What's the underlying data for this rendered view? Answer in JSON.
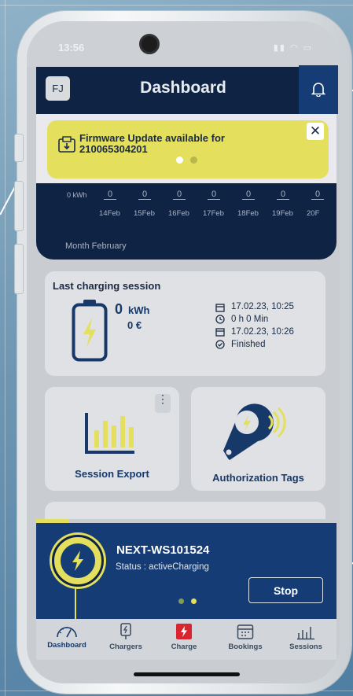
{
  "status": {
    "time": "13:56"
  },
  "header": {
    "title": "Dashboard",
    "avatar_initials": "FJ"
  },
  "banner": {
    "message": "Firmware Update available for 210065304201",
    "close_glyph": "✕",
    "carousel": {
      "active_index": 0,
      "count": 2
    }
  },
  "energy_chart": {
    "y_label": "0 kWh",
    "month_label": "Month February"
  },
  "chart_data": {
    "type": "bar",
    "categories": [
      "14Feb",
      "15Feb",
      "16Feb",
      "17Feb",
      "18Feb",
      "19Feb",
      "20F"
    ],
    "values": [
      0,
      0,
      0,
      0,
      0,
      0,
      0
    ],
    "value_labels": [
      "0",
      "0",
      "0",
      "0",
      "0",
      "0",
      "0"
    ],
    "ylabel": "0 kWh",
    "xlabel": "Month February"
  },
  "last_session": {
    "title": "Last charging session",
    "energy_value": "0",
    "energy_unit": "kWh",
    "cost": "0 €",
    "start": "17.02.23, 10:25",
    "duration": "0 h 0 Min",
    "end": "17.02.23, 10:26",
    "state": "Finished"
  },
  "cards": {
    "session_export": {
      "label": "Session Export",
      "menu_glyph": "⋮"
    },
    "authorization_tags": {
      "label": "Authorization Tags"
    }
  },
  "charging": {
    "station_name": "NEXT-WS101524",
    "status_text": "Status : activeCharging",
    "stop_label": "Stop",
    "progress": 0.11,
    "carousel": {
      "active_index": 1,
      "count": 2
    }
  },
  "tabs": [
    {
      "label": "Dashboard",
      "icon": "speedometer-icon",
      "active": true
    },
    {
      "label": "Chargers",
      "icon": "charger-plug-icon",
      "active": false
    },
    {
      "label": "Charge",
      "icon": "charge-bolt-icon",
      "active": false
    },
    {
      "label": "Bookings",
      "icon": "calendar-icon",
      "active": false
    },
    {
      "label": "Sessions",
      "icon": "bar-chart-icon",
      "active": false
    }
  ],
  "colors": {
    "navy": "#0f2444",
    "accent_blue": "#153c74",
    "yellow": "#e4e05e",
    "charge_red": "#d8252f"
  }
}
